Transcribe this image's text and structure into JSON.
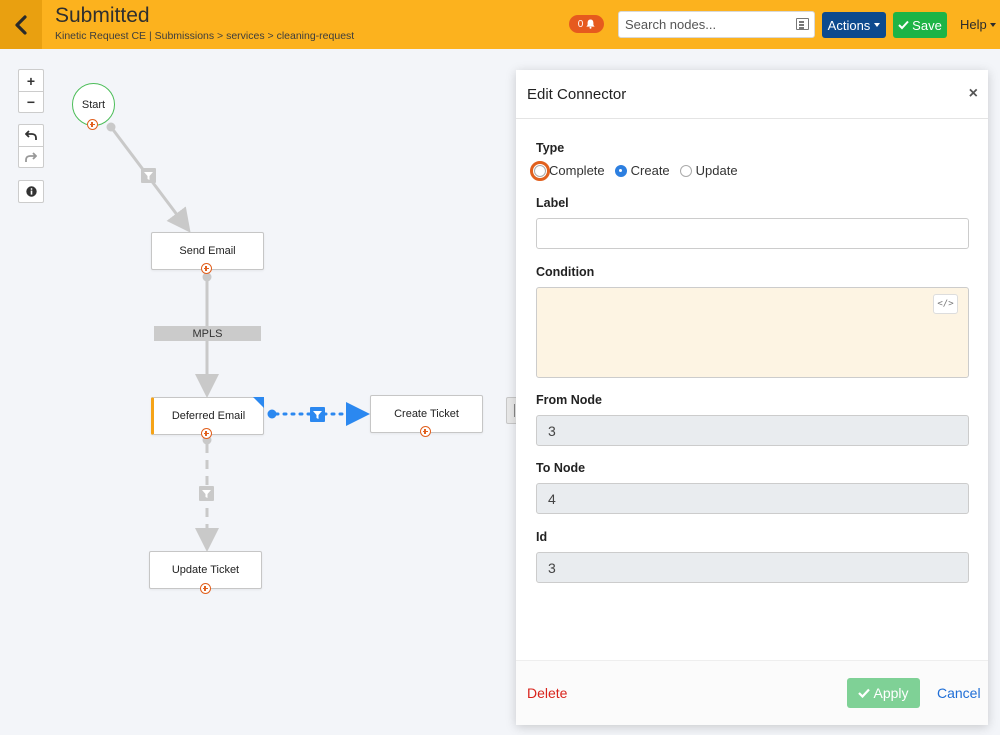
{
  "header": {
    "title": "Submitted",
    "breadcrumb": "Kinetic Request CE | Submissions > services > cleaning-request",
    "notifications_count": "0",
    "search_placeholder": "Search nodes...",
    "actions_label": "Actions",
    "save_label": "Save",
    "help_label": "Help"
  },
  "toolbar": {
    "zoom_in": "+",
    "zoom_out": "−",
    "undo_icon": "undo-icon",
    "redo_icon": "redo-icon",
    "info_icon": "info-icon"
  },
  "nodes": {
    "start": "Start",
    "send_email": "Send Email",
    "deferred_email": "Deferred Email",
    "create_ticket": "Create Ticket",
    "update_ticket": "Update Ticket"
  },
  "connector_labels": {
    "mpls": "MPLS"
  },
  "panel": {
    "title": "Edit Connector",
    "close": "×",
    "type_label": "Type",
    "type_options": [
      "Complete",
      "Create",
      "Update"
    ],
    "type_selected": "Create",
    "label_label": "Label",
    "label_value": "",
    "condition_label": "Condition",
    "code_toggle": "</>",
    "from_node_label": "From Node",
    "from_node_value": "3",
    "to_node_label": "To Node",
    "to_node_value": "4",
    "id_label": "Id",
    "id_value": "3",
    "delete_label": "Delete",
    "apply_label": "Apply",
    "cancel_label": "Cancel"
  },
  "colors": {
    "header_bg": "#fcb21e",
    "actions_bg": "#0d4a8e",
    "save_bg": "#1eb446",
    "notification_bg": "#e65a1e",
    "start_border": "#4bbd58",
    "selected_connector": "#2b88f0",
    "delete_red": "#d9241c",
    "cancel_blue": "#1f6ed6",
    "condition_bg": "#fdf4e3"
  }
}
